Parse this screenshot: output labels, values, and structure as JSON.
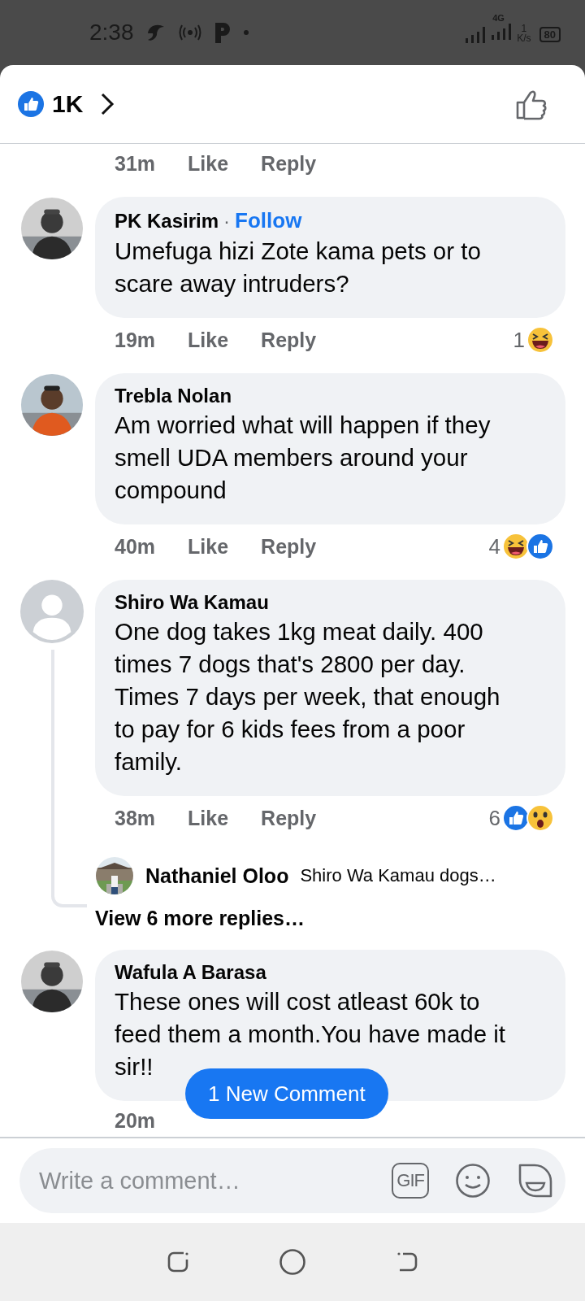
{
  "status_bar": {
    "time": "2:38",
    "network": "4G",
    "speed_value": "1",
    "speed_unit": "K/s",
    "battery": "80"
  },
  "header": {
    "like_count": "1K"
  },
  "top_actions": {
    "time": "31m",
    "like": "Like",
    "reply": "Reply"
  },
  "comments": [
    {
      "author": "PK Kasirim",
      "separator": "·",
      "follow": "Follow",
      "default_avatar": false,
      "text": "Umefuga hizi Zote kama pets or to scare away intruders?",
      "time": "19m",
      "like": "Like",
      "reply": "Reply",
      "reaction_count": "1",
      "reactions": [
        {
          "kind": "haha"
        }
      ]
    },
    {
      "author": "Trebla Nolan",
      "default_avatar": false,
      "text": "Am worried what will happen if they smell UDA members around your compound",
      "time": "40m",
      "like": "Like",
      "reply": "Reply",
      "reaction_count": "4",
      "reactions": [
        {
          "kind": "haha"
        },
        {
          "kind": "like"
        }
      ]
    },
    {
      "author": "Shiro Wa Kamau",
      "default_avatar": true,
      "text": "One dog takes 1kg meat daily. 400 times 7 dogs that's 2800 per day. Times 7 days per week, that enough to pay for 6 kids fees  from a poor family.",
      "time": "38m",
      "like": "Like",
      "reply": "Reply",
      "reaction_count": "6",
      "reactions": [
        {
          "kind": "like"
        },
        {
          "kind": "wow"
        }
      ],
      "reply_preview": {
        "author": "Nathaniel Oloo",
        "text": "Shiro Wa Kamau dogs…"
      },
      "more_replies": "View 6 more replies…"
    },
    {
      "author": "Wafula A Barasa",
      "default_avatar": false,
      "text": "These ones will cost atleast 60k to feed them a month.You have made it sir!!",
      "time": "20m"
    }
  ],
  "new_comment_button": "1 New Comment",
  "composer": {
    "placeholder": "Write a comment…",
    "gif": "GIF"
  }
}
